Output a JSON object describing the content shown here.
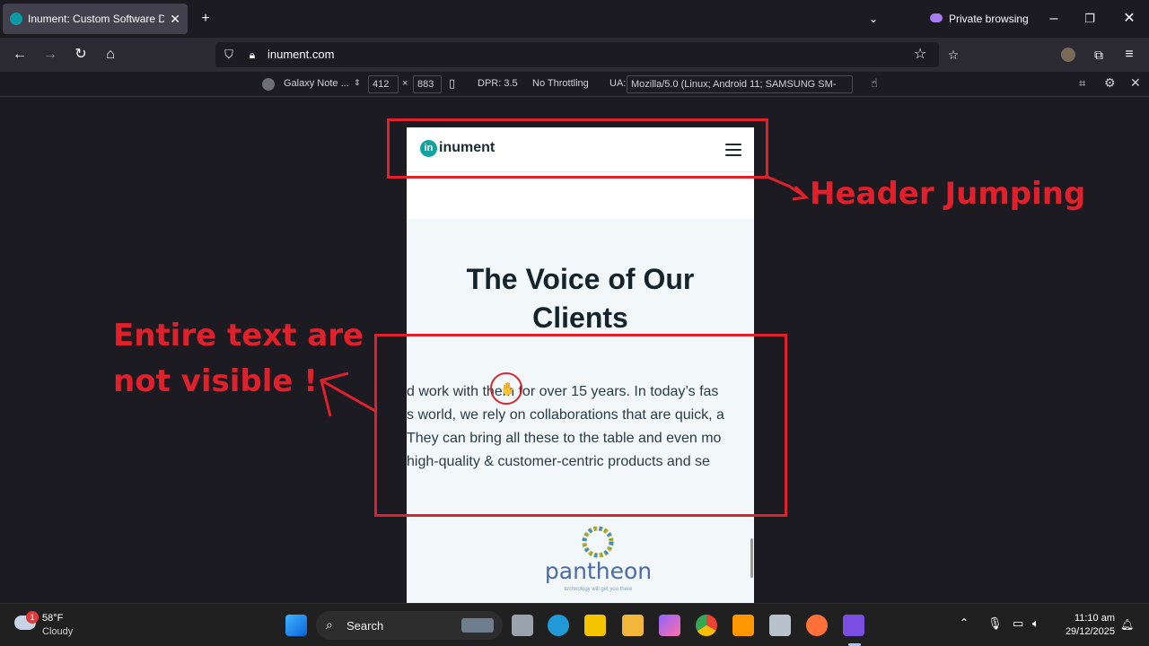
{
  "browser": {
    "tab_title": "Inument: Custom Software Devel...",
    "private_label": "Private browsing",
    "url": "inument.com"
  },
  "rdm": {
    "device": "Galaxy Note ...",
    "width": "412",
    "times": "×",
    "height": "883",
    "dpr": "DPR: 3.5",
    "throttling": "No Throttling",
    "ua_label": "UA:",
    "ua_value": "Mozilla/5.0 (Linux; Android 11; SAMSUNG SM-"
  },
  "site": {
    "logo_mark": "in",
    "logo_text": "inument",
    "heading_line1": "The Voice of Our",
    "heading_line2": "Clients",
    "quote_lines": [
      "d work with them for over 15 years. In today’s fas",
      "s world, we rely on collaborations that are quick, a",
      "They can bring all these to the table and even mo",
      "high-quality & customer-centric products and se"
    ],
    "client_name": "pantheon",
    "client_tagline": "technology will get you there"
  },
  "annotations": {
    "header_note": "Header Jumping",
    "text_note_line1": "Entire text are",
    "text_note_line2": "not visible !"
  },
  "taskbar": {
    "weather_temp": "58°F",
    "weather_desc": "Cloudy",
    "weather_badge": "1",
    "search_label": "Search",
    "time": "11:10 am",
    "date": "29/12/2025"
  },
  "colors": {
    "annotation_red": "#e0202a",
    "brand_teal": "#11a3a0",
    "pantheon_blue": "#4b6aa6"
  }
}
